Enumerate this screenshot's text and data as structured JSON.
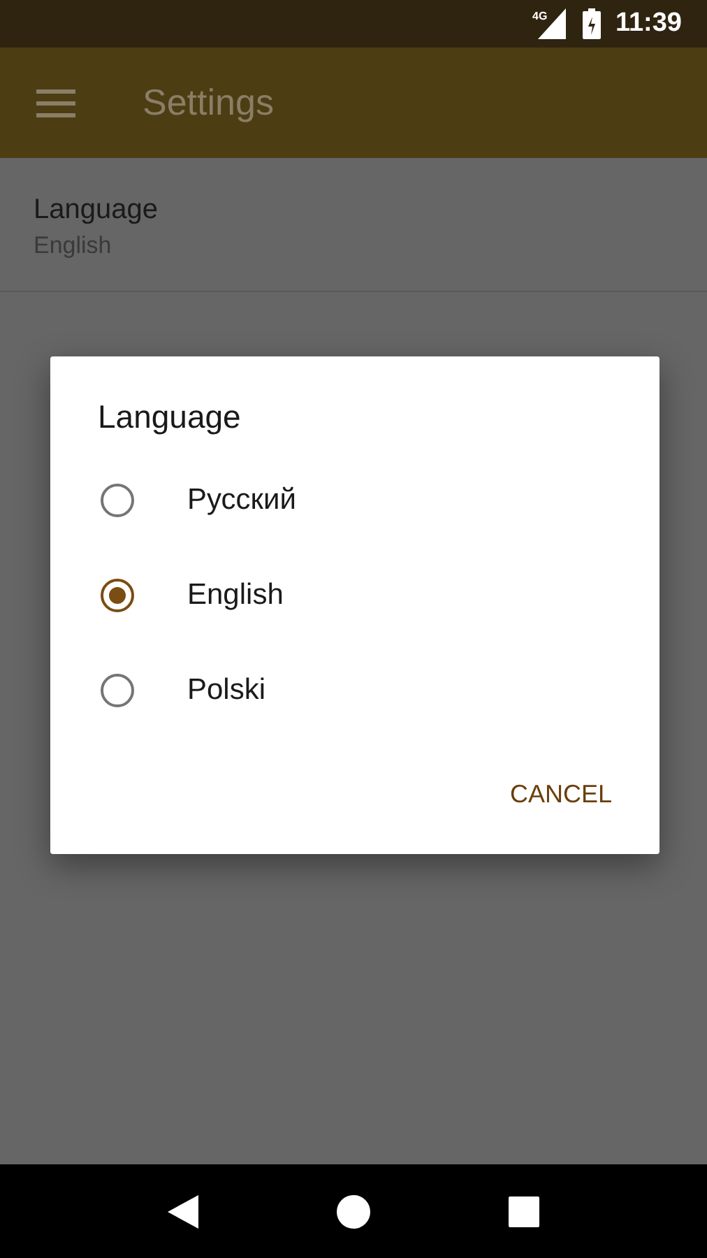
{
  "status_bar": {
    "network": "4G",
    "time": "11:39"
  },
  "app_bar": {
    "title": "Settings"
  },
  "settings": [
    {
      "title": "Language",
      "summary": "English"
    }
  ],
  "dialog": {
    "title": "Language",
    "options": [
      {
        "label": "Русский",
        "selected": false
      },
      {
        "label": "English",
        "selected": true
      },
      {
        "label": "Polski",
        "selected": false
      }
    ],
    "buttons": [
      "CANCEL"
    ]
  }
}
